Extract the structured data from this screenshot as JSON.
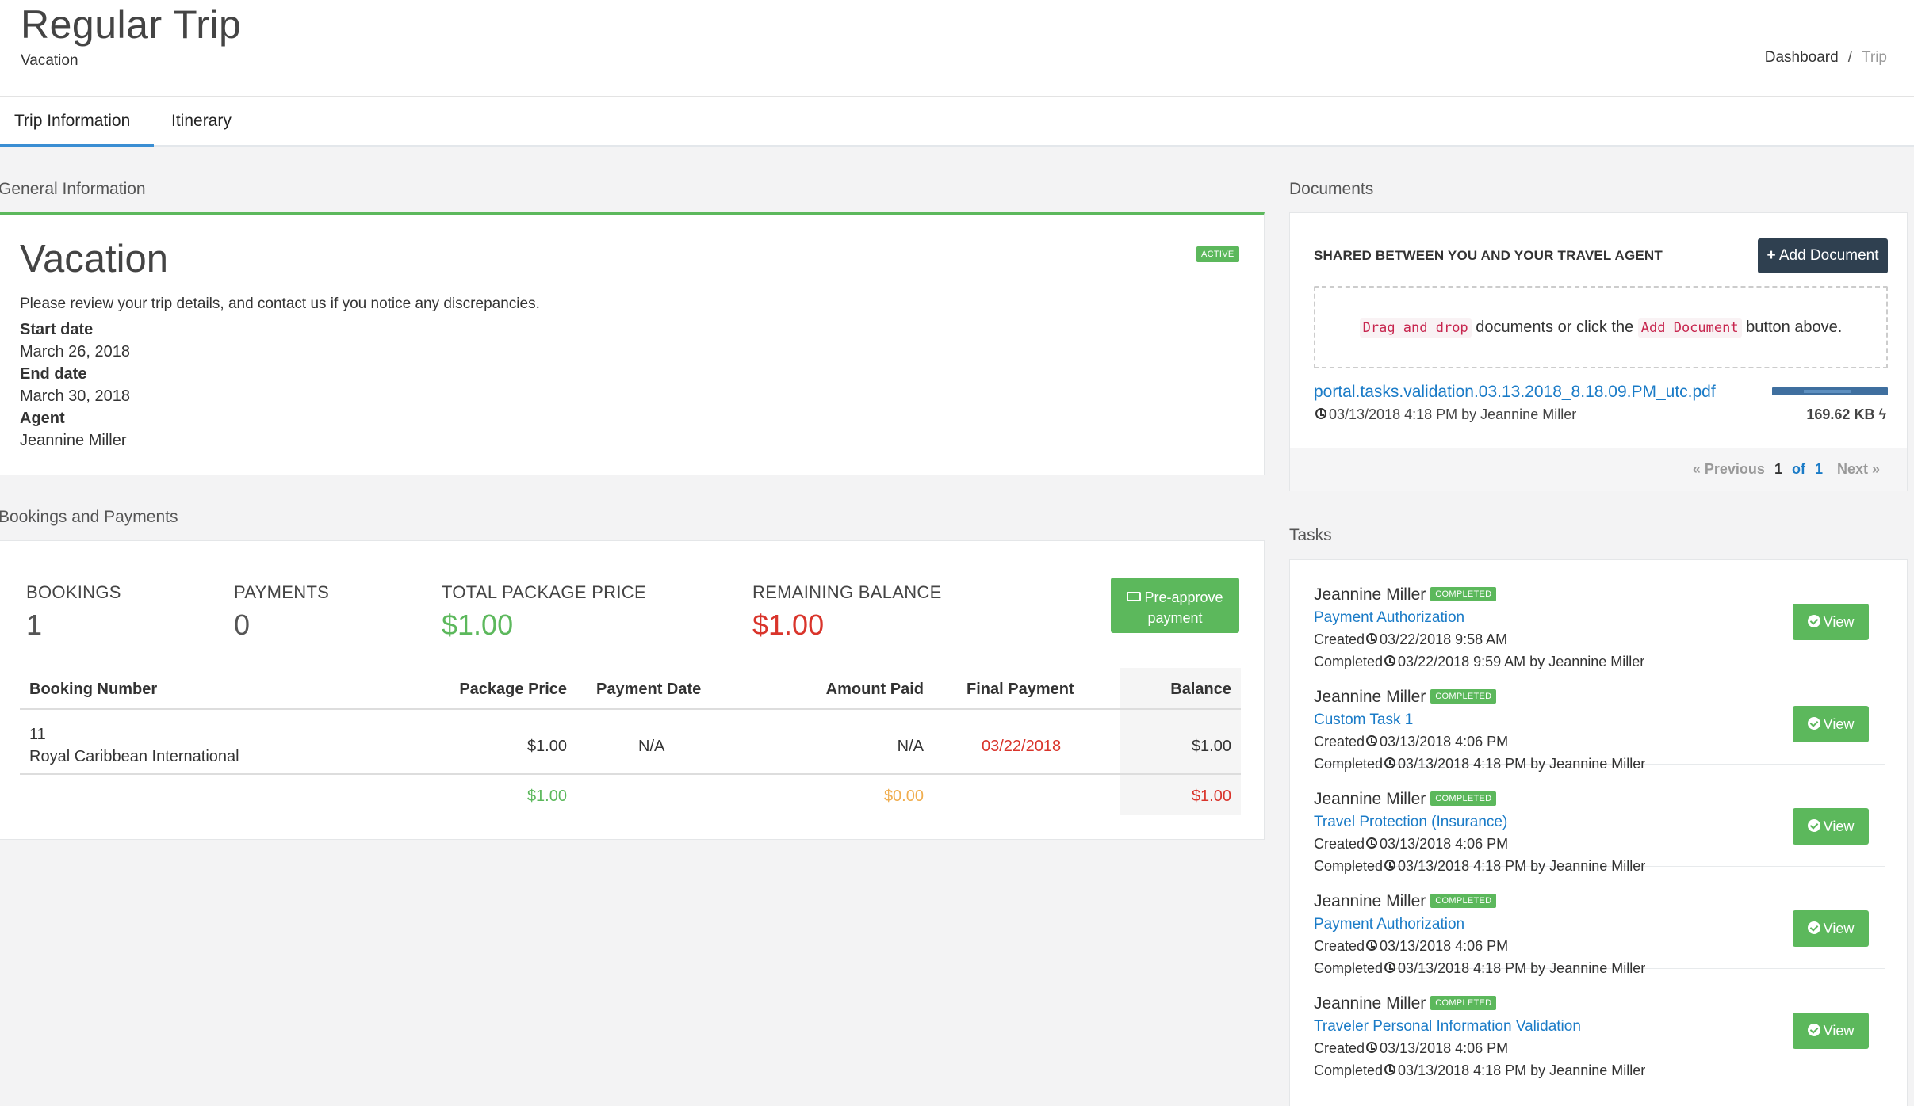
{
  "header": {
    "title": "Regular Trip",
    "subtitle": "Vacation",
    "breadcrumb": {
      "home": "Dashboard",
      "separator": "/",
      "current": "Trip"
    }
  },
  "tabs": [
    {
      "label": "Trip Information",
      "active": true
    },
    {
      "label": "Itinerary",
      "active": false
    }
  ],
  "general": {
    "section_title": "General Information",
    "heading": "Vacation",
    "status_badge": "ACTIVE",
    "intro": "Please review your trip details, and contact us if you notice any discrepancies.",
    "start_label": "Start date",
    "start_value": "March 26, 2018",
    "end_label": "End date",
    "end_value": "March 30, 2018",
    "agent_label": "Agent",
    "agent_value": "Jeannine Miller"
  },
  "bookings": {
    "section_title": "Bookings and Payments",
    "stats": {
      "bookings_label": "BOOKINGS",
      "bookings_value": "1",
      "payments_label": "PAYMENTS",
      "payments_value": "0",
      "total_label": "TOTAL PACKAGE PRICE",
      "total_value": "$1.00",
      "remaining_label": "REMAINING BALANCE",
      "remaining_value": "$1.00"
    },
    "preapprove_line1": "Pre-approve",
    "preapprove_line2": "payment",
    "columns": {
      "booking_number": "Booking Number",
      "package_price": "Package Price",
      "payment_date": "Payment Date",
      "amount_paid": "Amount Paid",
      "final_payment": "Final Payment",
      "balance": "Balance"
    },
    "rows": [
      {
        "number": "11",
        "vendor": "Royal Caribbean International",
        "package_price": "$1.00",
        "payment_date": "N/A",
        "amount_paid": "N/A",
        "final_payment": "03/22/2018",
        "balance": "$1.00"
      }
    ],
    "totals": {
      "package_price": "$1.00",
      "amount_paid": "$0.00",
      "balance": "$1.00"
    }
  },
  "documents": {
    "section_title": "Documents",
    "shared_heading": "SHARED BETWEEN YOU AND YOUR TRAVEL AGENT",
    "add_button": "Add Document",
    "dropzone": {
      "code1": "Drag and drop",
      "text1": " documents or click the ",
      "code2": "Add Document",
      "text2": " button above."
    },
    "file": {
      "name": "portal.tasks.validation.03.13.2018_8.18.09.PM_utc.pdf",
      "meta": "03/13/2018 4:18 PM by Jeannine Miller",
      "size": "169.62 KB"
    },
    "pager": {
      "previous": "« Previous",
      "current": "1",
      "of": "of",
      "total": "1",
      "next": "Next »"
    }
  },
  "tasks": {
    "section_title": "Tasks",
    "view_label": "View",
    "items": [
      {
        "assignee": "Jeannine Miller",
        "status": "COMPLETED",
        "title": "Payment Authorization",
        "created_label": "Created",
        "created": "03/22/2018 9:58 AM",
        "completed_label": "Completed",
        "completed": "03/22/2018 9:59 AM by Jeannine Miller"
      },
      {
        "assignee": "Jeannine Miller",
        "status": "COMPLETED",
        "title": "Custom Task 1",
        "created_label": "Created",
        "created": "03/13/2018 4:06 PM",
        "completed_label": "Completed",
        "completed": "03/13/2018 4:18 PM by Jeannine Miller"
      },
      {
        "assignee": "Jeannine Miller",
        "status": "COMPLETED",
        "title": "Travel Protection (Insurance)",
        "created_label": "Created",
        "created": "03/13/2018 4:06 PM",
        "completed_label": "Completed",
        "completed": "03/13/2018 4:18 PM by Jeannine Miller"
      },
      {
        "assignee": "Jeannine Miller",
        "status": "COMPLETED",
        "title": "Payment Authorization",
        "created_label": "Created",
        "created": "03/13/2018 4:06 PM",
        "completed_label": "Completed",
        "completed": "03/13/2018 4:18 PM by Jeannine Miller"
      },
      {
        "assignee": "Jeannine Miller",
        "status": "COMPLETED",
        "title": "Traveler Personal Information Validation",
        "created_label": "Created",
        "created": "03/13/2018 4:06 PM",
        "completed_label": "Completed",
        "completed": "03/13/2018 4:18 PM by Jeannine Miller"
      }
    ]
  },
  "colors": {
    "green": "#5cb85c",
    "red": "#d9342b",
    "orange": "#f0ad4e",
    "link": "#1a7bc7",
    "dark_button": "#2f4050"
  }
}
